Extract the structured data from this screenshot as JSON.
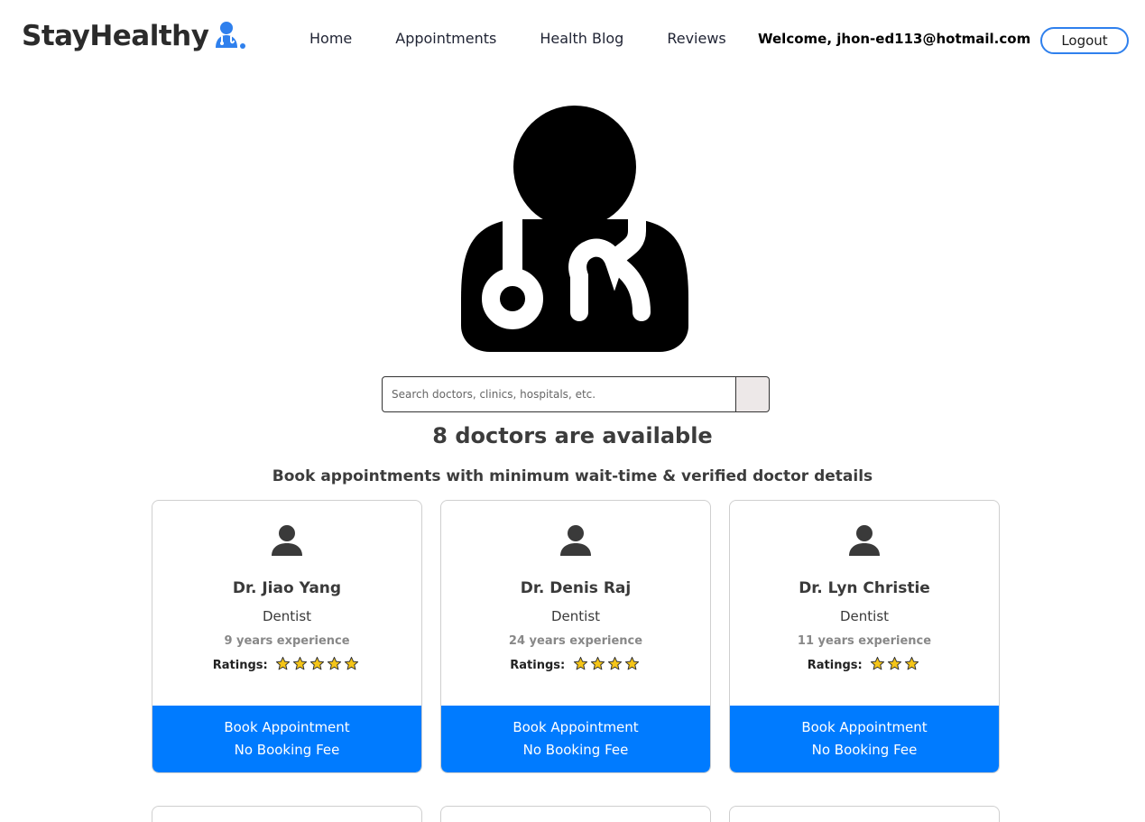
{
  "brand": {
    "name": "StayHealthy",
    "icon": "doctor-logo-icon"
  },
  "nav": {
    "links": [
      "Home",
      "Appointments",
      "Health Blog",
      "Reviews"
    ],
    "welcome": "Welcome, jhon-ed113@hotmail.com",
    "logout_label": "Logout"
  },
  "hero": {
    "icon": "doctor-stethoscope-icon"
  },
  "search": {
    "placeholder": "Search doctors, clinics, hospitals, etc.",
    "value": ""
  },
  "availability": {
    "title": "8 doctors are available",
    "subtitle": "Book appointments with minimum wait-time & verified doctor details"
  },
  "cards_label": {
    "ratings": "Ratings:",
    "book_line1": "Book Appointment",
    "book_line2": "No Booking Fee"
  },
  "doctors": [
    {
      "name": "Dr. Jiao Yang",
      "specialty": "Dentist",
      "experience": "9 years experience",
      "rating": 5
    },
    {
      "name": "Dr. Denis Raj",
      "specialty": "Dentist",
      "experience": "24 years experience",
      "rating": 4
    },
    {
      "name": "Dr. Lyn Christie",
      "specialty": "Dentist",
      "experience": "11 years experience",
      "rating": 3
    }
  ],
  "colors": {
    "accent": "#007bff",
    "logout_border": "#2f80ed",
    "star": "#f5c518"
  }
}
